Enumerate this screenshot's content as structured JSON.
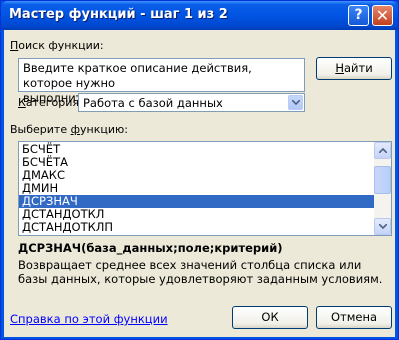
{
  "window": {
    "title": "Мастер функций - шаг 1 из 2",
    "help_button": "?",
    "close_button": "✕"
  },
  "search": {
    "label_main": "оиск функции:",
    "label_mnemonic": "П",
    "value_line1": "Введите краткое описание действия, которое нужно",
    "value_line2": "выполнить, и нажмите кнопку \"Найти\"",
    "find_button_mnemonic": "Н",
    "find_button_rest": "айти"
  },
  "category": {
    "label_mnemonic": "К",
    "label_rest": "атегория:",
    "selected": "Работа с базой данных"
  },
  "functions": {
    "label_pre": "Выберите ",
    "label_mnemonic": "ф",
    "label_post": "ункцию:",
    "items": [
      "БСЧЁТ",
      "БСЧЁТА",
      "ДМАКС",
      "ДМИН",
      "ДСРЗНАЧ",
      "ДСТАНДОТКЛ",
      "ДСТАНДОТКЛП"
    ],
    "selected_index": 4
  },
  "details": {
    "signature": "ДСРЗНАЧ(база_данных;поле;критерий)",
    "description": "Возвращает среднее всех значений столбца списка или базы данных, которые удовлетворяют заданным условиям."
  },
  "footer": {
    "help_link": "Справка по этой функции",
    "ok": "ОК",
    "cancel": "Отмена"
  },
  "colors": {
    "title_bar": "#0054e3",
    "dialog_bg": "#ece9d8",
    "selection": "#316ac5",
    "link": "#0000ff"
  }
}
